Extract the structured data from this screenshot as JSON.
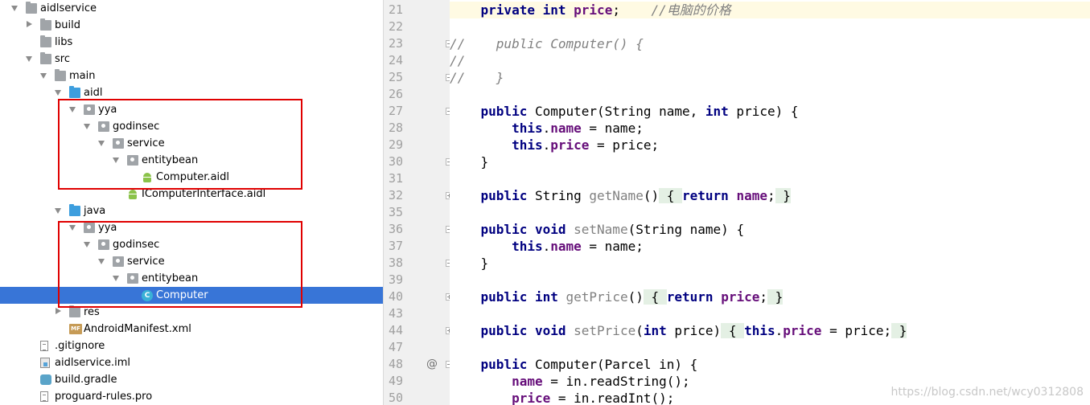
{
  "tree": {
    "items": [
      {
        "label": "aidlservice",
        "depth": 0,
        "icon": "module-folder-icon",
        "expanded": true
      },
      {
        "label": "build",
        "depth": 1,
        "icon": "folder-icon",
        "expanded": false
      },
      {
        "label": "libs",
        "depth": 1,
        "icon": "folder-icon",
        "expanded": null
      },
      {
        "label": "src",
        "depth": 1,
        "icon": "folder-icon",
        "expanded": true
      },
      {
        "label": "main",
        "depth": 2,
        "icon": "folder-icon",
        "expanded": true
      },
      {
        "label": "aidl",
        "depth": 3,
        "icon": "source-folder-icon",
        "expanded": true
      },
      {
        "label": "yya",
        "depth": 4,
        "icon": "package-icon",
        "expanded": true
      },
      {
        "label": "godinsec",
        "depth": 5,
        "icon": "package-icon",
        "expanded": true
      },
      {
        "label": "service",
        "depth": 6,
        "icon": "package-icon",
        "expanded": true
      },
      {
        "label": "entitybean",
        "depth": 7,
        "icon": "package-icon",
        "expanded": true
      },
      {
        "label": "Computer.aidl",
        "depth": 8,
        "icon": "android-icon",
        "expanded": null
      },
      {
        "label": "IComputerInterface.aidl",
        "depth": 7,
        "icon": "android-icon",
        "expanded": null
      },
      {
        "label": "java",
        "depth": 3,
        "icon": "source-folder-icon",
        "expanded": true
      },
      {
        "label": "yya",
        "depth": 4,
        "icon": "package-icon",
        "expanded": true
      },
      {
        "label": "godinsec",
        "depth": 5,
        "icon": "package-icon",
        "expanded": true
      },
      {
        "label": "service",
        "depth": 6,
        "icon": "package-icon",
        "expanded": true
      },
      {
        "label": "entitybean",
        "depth": 7,
        "icon": "package-icon",
        "expanded": true
      },
      {
        "label": "Computer",
        "depth": 8,
        "icon": "class-icon",
        "expanded": null,
        "selected": true
      },
      {
        "label": "res",
        "depth": 3,
        "icon": "folder-icon",
        "expanded": false
      },
      {
        "label": "AndroidManifest.xml",
        "depth": 3,
        "icon": "manifest-icon",
        "expanded": null
      },
      {
        "label": ".gitignore",
        "depth": 1,
        "icon": "file-icon",
        "expanded": null
      },
      {
        "label": "aidlservice.iml",
        "depth": 1,
        "icon": "module-file-icon",
        "expanded": null
      },
      {
        "label": "build.gradle",
        "depth": 1,
        "icon": "gradle-icon",
        "expanded": null
      },
      {
        "label": "proguard-rules.pro",
        "depth": 1,
        "icon": "file-icon",
        "expanded": null
      }
    ]
  },
  "editor": {
    "lines": [
      {
        "num": "21",
        "current": true,
        "segments": [
          {
            "t": "    "
          },
          {
            "t": "private",
            "c": "kw"
          },
          {
            "t": " "
          },
          {
            "t": "int",
            "c": "kw"
          },
          {
            "t": " "
          },
          {
            "t": "price",
            "c": "fld"
          },
          {
            "t": ";    "
          },
          {
            "t": "//电脑的价格",
            "c": "cm"
          }
        ]
      },
      {
        "num": "22",
        "segments": []
      },
      {
        "num": "23",
        "fold": "minus",
        "segments": [
          {
            "t": "//    public Computer() {",
            "c": "cm"
          }
        ]
      },
      {
        "num": "24",
        "segments": [
          {
            "t": "//",
            "c": "cm"
          }
        ]
      },
      {
        "num": "25",
        "fold": "minus",
        "segments": [
          {
            "t": "//    }",
            "c": "cm"
          }
        ]
      },
      {
        "num": "26",
        "segments": []
      },
      {
        "num": "27",
        "fold": "minus",
        "segments": [
          {
            "t": "    "
          },
          {
            "t": "public",
            "c": "kw"
          },
          {
            "t": " Computer(String name, "
          },
          {
            "t": "int",
            "c": "kw"
          },
          {
            "t": " price) {"
          }
        ]
      },
      {
        "num": "28",
        "segments": [
          {
            "t": "        "
          },
          {
            "t": "this",
            "c": "kw"
          },
          {
            "t": "."
          },
          {
            "t": "name",
            "c": "fld"
          },
          {
            "t": " = name;"
          }
        ]
      },
      {
        "num": "29",
        "segments": [
          {
            "t": "        "
          },
          {
            "t": "this",
            "c": "kw"
          },
          {
            "t": "."
          },
          {
            "t": "price",
            "c": "fld"
          },
          {
            "t": " = price;"
          }
        ]
      },
      {
        "num": "30",
        "fold": "minus",
        "segments": [
          {
            "t": "    }"
          }
        ]
      },
      {
        "num": "31",
        "segments": []
      },
      {
        "num": "32",
        "fold": "plus",
        "segments": [
          {
            "t": "    "
          },
          {
            "t": "public",
            "c": "kw"
          },
          {
            "t": " String "
          },
          {
            "t": "getName",
            "c": "mref"
          },
          {
            "t": "()"
          },
          {
            "t": " { ",
            "c": "fold-hl"
          },
          {
            "t": "return",
            "c": "kw"
          },
          {
            "t": " "
          },
          {
            "t": "name",
            "c": "fld"
          },
          {
            "t": ";"
          },
          {
            "t": " }",
            "c": "fold-hl"
          }
        ]
      },
      {
        "num": "35",
        "segments": []
      },
      {
        "num": "36",
        "fold": "minus",
        "segments": [
          {
            "t": "    "
          },
          {
            "t": "public",
            "c": "kw"
          },
          {
            "t": " "
          },
          {
            "t": "void",
            "c": "kw"
          },
          {
            "t": " "
          },
          {
            "t": "setName",
            "c": "mref"
          },
          {
            "t": "(String name) {"
          }
        ]
      },
      {
        "num": "37",
        "segments": [
          {
            "t": "        "
          },
          {
            "t": "this",
            "c": "kw"
          },
          {
            "t": "."
          },
          {
            "t": "name",
            "c": "fld"
          },
          {
            "t": " = name;"
          }
        ]
      },
      {
        "num": "38",
        "fold": "minus",
        "segments": [
          {
            "t": "    }"
          }
        ]
      },
      {
        "num": "39",
        "segments": []
      },
      {
        "num": "40",
        "fold": "plus",
        "segments": [
          {
            "t": "    "
          },
          {
            "t": "public",
            "c": "kw"
          },
          {
            "t": " "
          },
          {
            "t": "int",
            "c": "kw"
          },
          {
            "t": " "
          },
          {
            "t": "getPrice",
            "c": "mref"
          },
          {
            "t": "()"
          },
          {
            "t": " { ",
            "c": "fold-hl"
          },
          {
            "t": "return",
            "c": "kw"
          },
          {
            "t": " "
          },
          {
            "t": "price",
            "c": "fld"
          },
          {
            "t": ";"
          },
          {
            "t": " }",
            "c": "fold-hl"
          }
        ]
      },
      {
        "num": "43",
        "segments": []
      },
      {
        "num": "44",
        "fold": "plus",
        "segments": [
          {
            "t": "    "
          },
          {
            "t": "public",
            "c": "kw"
          },
          {
            "t": " "
          },
          {
            "t": "void",
            "c": "kw"
          },
          {
            "t": " "
          },
          {
            "t": "setPrice",
            "c": "mref"
          },
          {
            "t": "("
          },
          {
            "t": "int",
            "c": "kw"
          },
          {
            "t": " price)"
          },
          {
            "t": " { ",
            "c": "fold-hl"
          },
          {
            "t": "this",
            "c": "kw"
          },
          {
            "t": "."
          },
          {
            "t": "price",
            "c": "fld"
          },
          {
            "t": " = price;"
          },
          {
            "t": " }",
            "c": "fold-hl"
          }
        ]
      },
      {
        "num": "47",
        "segments": []
      },
      {
        "num": "48",
        "fold": "minus",
        "annotation": "@",
        "segments": [
          {
            "t": "    "
          },
          {
            "t": "public",
            "c": "kw"
          },
          {
            "t": " Computer(Parcel in) {"
          }
        ]
      },
      {
        "num": "49",
        "segments": [
          {
            "t": "        "
          },
          {
            "t": "name",
            "c": "fld"
          },
          {
            "t": " = in.readString();"
          }
        ]
      },
      {
        "num": "50",
        "segments": [
          {
            "t": "        "
          },
          {
            "t": "price",
            "c": "fld"
          },
          {
            "t": " = in.readInt();"
          }
        ]
      }
    ]
  },
  "watermark": "https://blog.csdn.net/wcy0312808",
  "colors": {
    "selection": "#3875d7",
    "highlight_box": "#e00000",
    "keyword": "#000080",
    "field": "#660e7a",
    "comment": "#808080",
    "current_line": "#fffae3"
  }
}
